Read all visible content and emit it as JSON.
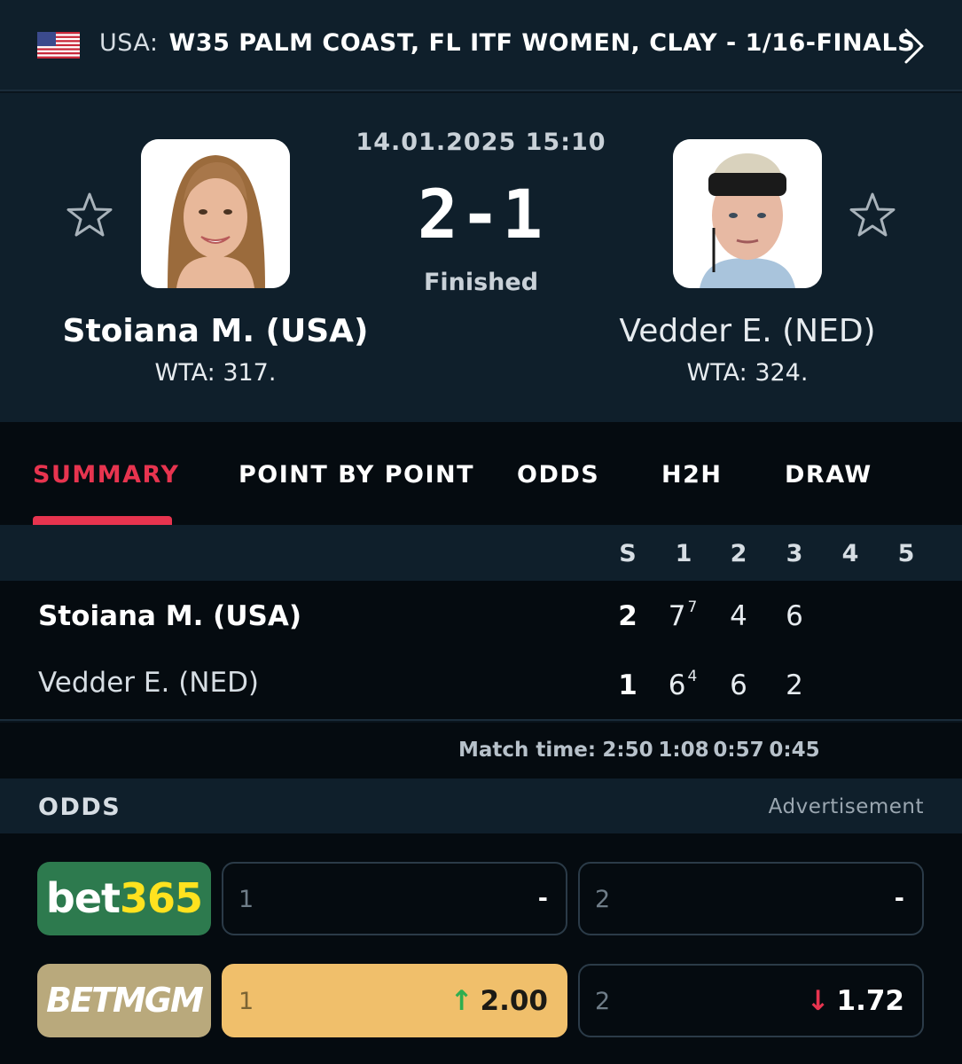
{
  "header": {
    "country": "USA:",
    "tournament": "W35 PALM COAST, FL ITF WOMEN, CLAY - 1/16-FINALS"
  },
  "match": {
    "datetime": "14.01.2025 15:10",
    "score": "2-1",
    "status": "Finished",
    "home": {
      "name": "Stoiana M. (USA)",
      "rank": "WTA: 317."
    },
    "away": {
      "name": "Vedder E. (NED)",
      "rank": "WTA: 324."
    }
  },
  "tabs": [
    "SUMMARY",
    "POINT BY POINT",
    "ODDS",
    "H2H",
    "DRAW"
  ],
  "active_tab": "SUMMARY",
  "table": {
    "headers": [
      "S",
      "1",
      "2",
      "3",
      "4",
      "5"
    ],
    "rows": [
      {
        "name": "Stoiana M. (USA)",
        "sets": "2",
        "set1": "7",
        "set1_tb": "7",
        "set2": "4",
        "set3": "6"
      },
      {
        "name": "Vedder E. (NED)",
        "sets": "1",
        "set1": "6",
        "set1_tb": "4",
        "set2": "6",
        "set3": "2"
      }
    ],
    "match_time_label": "Match time:",
    "match_times": [
      "2:50",
      "1:08",
      "0:57",
      "0:45"
    ]
  },
  "odds": {
    "title": "ODDS",
    "advertisement": "Advertisement",
    "bookmakers": [
      {
        "name_part1": "bet",
        "name_part2": "365",
        "home_label": "1",
        "home_value": "-",
        "away_label": "2",
        "away_value": "-"
      },
      {
        "name": "BETMGM",
        "home_label": "1",
        "home_arrow": "↑",
        "home_value": "2.00",
        "away_label": "2",
        "away_arrow": "↓",
        "away_value": "1.72"
      }
    ]
  },
  "colors": {
    "accent": "#e7344f",
    "background": "#0a141c",
    "panel": "#0f1f2b",
    "highlight_odds": "#f0bf6b",
    "bet365_green": "#2d7a4e",
    "betmgm_gold": "#b9a97c"
  }
}
